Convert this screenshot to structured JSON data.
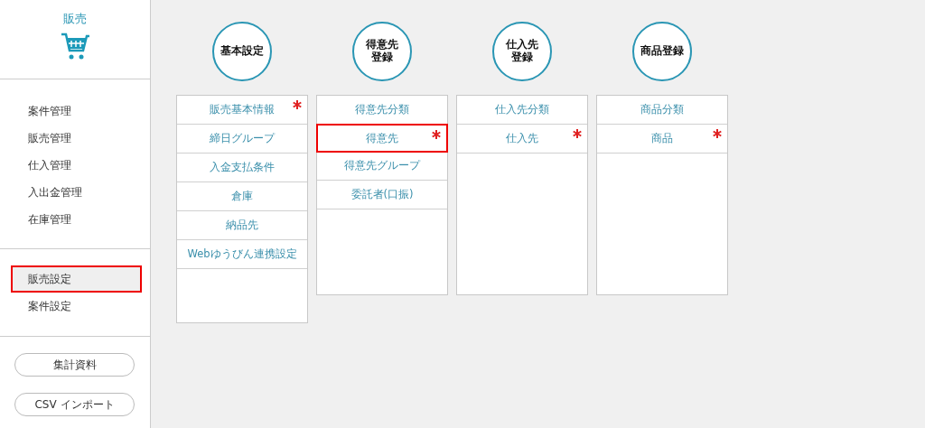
{
  "sidebar": {
    "title": "販売",
    "menu": [
      {
        "label": "案件管理",
        "selected": false
      },
      {
        "label": "販売管理",
        "selected": false
      },
      {
        "label": "仕入管理",
        "selected": false
      },
      {
        "label": "入出金管理",
        "selected": false
      },
      {
        "label": "在庫管理",
        "selected": false
      }
    ],
    "settings": [
      {
        "label": "販売設定",
        "selected": true,
        "highlighted": true
      },
      {
        "label": "案件設定",
        "selected": false,
        "highlighted": false
      }
    ],
    "buttons": [
      "集計資料",
      "CSV インポート"
    ]
  },
  "columns": [
    {
      "title_lines": [
        "基本設定"
      ],
      "items": [
        {
          "label": "販売基本情報",
          "required": true,
          "highlighted": false
        },
        {
          "label": "締日グループ",
          "required": false,
          "highlighted": false
        },
        {
          "label": "入金支払条件",
          "required": false,
          "highlighted": false
        },
        {
          "label": "倉庫",
          "required": false,
          "highlighted": false
        },
        {
          "label": "納品先",
          "required": false,
          "highlighted": false
        },
        {
          "label": "Webゆうびん連携設定",
          "required": false,
          "highlighted": false
        }
      ]
    },
    {
      "title_lines": [
        "得意先",
        "登録"
      ],
      "items": [
        {
          "label": "得意先分類",
          "required": false,
          "highlighted": false
        },
        {
          "label": "得意先",
          "required": true,
          "highlighted": true
        },
        {
          "label": "得意先グループ",
          "required": false,
          "highlighted": false
        },
        {
          "label": "委託者(口振)",
          "required": false,
          "highlighted": false
        }
      ]
    },
    {
      "title_lines": [
        "仕入先",
        "登録"
      ],
      "items": [
        {
          "label": "仕入先分類",
          "required": false,
          "highlighted": false
        },
        {
          "label": "仕入先",
          "required": true,
          "highlighted": false
        }
      ]
    },
    {
      "title_lines": [
        "商品登録"
      ],
      "items": [
        {
          "label": "商品分類",
          "required": false,
          "highlighted": false
        },
        {
          "label": "商品",
          "required": true,
          "highlighted": false
        }
      ]
    }
  ]
}
